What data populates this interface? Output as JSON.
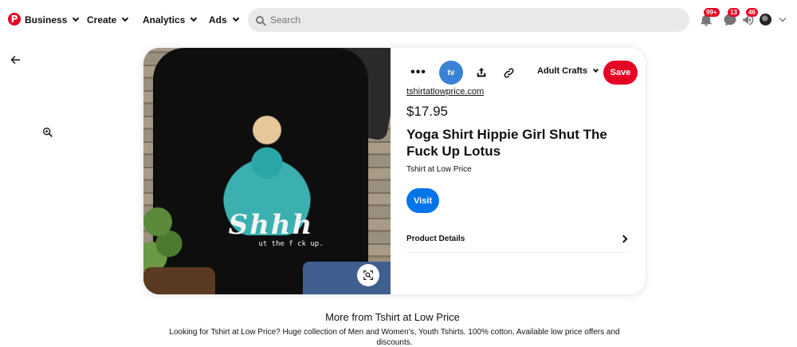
{
  "nav": {
    "logo_letter": "P",
    "items": [
      {
        "label": "Business"
      },
      {
        "label": "Create"
      },
      {
        "label": "Analytics"
      },
      {
        "label": "Ads"
      }
    ],
    "search_placeholder": "Search",
    "notifications": {
      "updates_badge": "99+",
      "messages_badge": "13",
      "inbox_badge": "46"
    },
    "icons": [
      "pinterest-logo",
      "chevron-down-icon",
      "search-icon",
      "bell-icon",
      "chat-icon",
      "megaphone-icon",
      "avatar",
      "chevron-down-icon"
    ]
  },
  "page": {
    "back_icon": "arrow-left-icon",
    "zoom_icon": "zoom-in-icon"
  },
  "pin": {
    "image": {
      "shirt_text": "Shhh",
      "shirt_subtext": "ut the f ck up.",
      "lens_icon": "visual-search-icon"
    },
    "toolbar": {
      "more_label": "•••",
      "share_avatar_text": "tv",
      "board_name": "Adult Crafts",
      "save_label": "Save"
    },
    "domain": "tshirtatlowprice.com",
    "price": "$17.95",
    "title": "Yoga Shirt Hippie Girl Shut The Fuck Up Lotus",
    "seller": "Tshirt at Low Price",
    "visit_label": "Visit",
    "product_details_label": "Product Details"
  },
  "more_from": {
    "title": "More from  Tshirt at Low Price",
    "description": "Looking for Tshirt at Low Price? Huge collection of Men and Women's, Youth Tshirts. 100% cotton, Available low price offers and discounts."
  },
  "colors": {
    "brand_red": "#e60023",
    "visit_blue": "#0074e8",
    "search_bg": "#e9e9e9"
  }
}
